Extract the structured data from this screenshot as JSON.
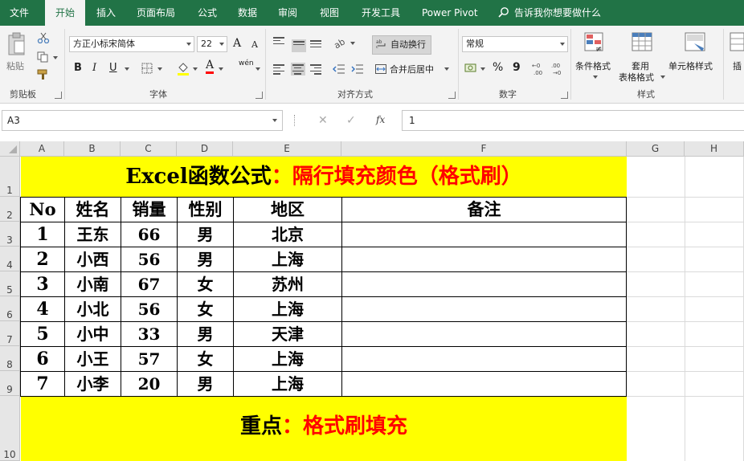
{
  "menu": {
    "tabs": [
      "文件",
      "开始",
      "插入",
      "页面布局",
      "公式",
      "数据",
      "审阅",
      "视图",
      "开发工具",
      "Power Pivot"
    ],
    "active_tab": "开始",
    "search_placeholder": "告诉我你想要做什么",
    "accent_color": "#217346"
  },
  "ribbon": {
    "clipboard": {
      "paste_label": "粘贴",
      "group_label": "剪贴板"
    },
    "font": {
      "font_name": "方正小标宋简体",
      "font_size": "22",
      "grow": "A",
      "shrink": "A",
      "bold": "B",
      "italic": "I",
      "underline": "U",
      "font_color_letter": "A",
      "phonetic": "wén",
      "group_label": "字体"
    },
    "alignment": {
      "wrap_text": "自动换行",
      "merge_center": "合并后居中",
      "group_label": "对齐方式"
    },
    "number": {
      "format": "常规",
      "percent": "%",
      "comma": "9",
      "group_label": "数字"
    },
    "styles": {
      "conditional": "条件格式",
      "table_format_line1": "套用",
      "table_format_line2": "表格格式",
      "cell_styles": "单元格样式",
      "group_label": "样式"
    },
    "cells": {
      "insert": "插"
    }
  },
  "formula_bar": {
    "name_box": "A3",
    "cancel": "✕",
    "enter": "✓",
    "fx": "fx",
    "content": "1"
  },
  "columns": [
    "A",
    "B",
    "C",
    "D",
    "E",
    "F",
    "G",
    "H"
  ],
  "rows": [
    "1",
    "2",
    "3",
    "4",
    "5",
    "6",
    "7",
    "8",
    "9",
    "10"
  ],
  "sheet": {
    "title_black": "Excel函数公式",
    "title_red": "：隔行填充颜色（格式刷）",
    "headers": [
      "No",
      "姓名",
      "销量",
      "性别",
      "地区",
      "备注"
    ],
    "records": [
      [
        "1",
        "王东",
        "66",
        "男",
        "北京",
        ""
      ],
      [
        "2",
        "小西",
        "56",
        "男",
        "上海",
        ""
      ],
      [
        "3",
        "小南",
        "67",
        "女",
        "苏州",
        ""
      ],
      [
        "4",
        "小北",
        "56",
        "女",
        "上海",
        ""
      ],
      [
        "5",
        "小中",
        "33",
        "男",
        "天津",
        ""
      ],
      [
        "6",
        "小王",
        "57",
        "女",
        "上海",
        ""
      ],
      [
        "7",
        "小李",
        "20",
        "男",
        "上海",
        ""
      ]
    ],
    "footer_black": "重点",
    "footer_red": "：格式刷填充",
    "highlight_color": "#ffff00",
    "emphasis_color": "#ff0000"
  }
}
